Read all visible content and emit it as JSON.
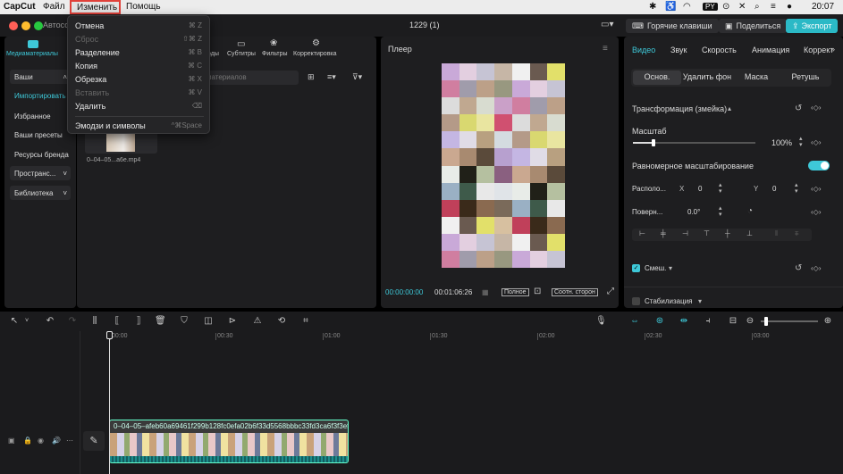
{
  "menubar": {
    "app_name": "CapCut",
    "file": "Файл",
    "edit": "Изменить",
    "help": "Помощь",
    "input_lang": "PY",
    "clock": "20:07"
  },
  "titlebar": {
    "project_title": "Автосо",
    "center_title": "1229 (1)",
    "hotkeys": "Горячие клавиши",
    "share": "Поделиться",
    "export": "Экспорт"
  },
  "edit_menu": {
    "items": [
      {
        "label": "Отмена",
        "key": "⌘ Z",
        "enabled": true
      },
      {
        "label": "Сброс",
        "key": "⇧⌘ Z",
        "enabled": false
      },
      {
        "label": "Разделение",
        "key": "⌘ B",
        "enabled": true
      },
      {
        "label": "Копия",
        "key": "⌘ C",
        "enabled": true
      },
      {
        "label": "Обрезка",
        "key": "⌘ X",
        "enabled": true
      },
      {
        "label": "Вставить",
        "key": "⌘ V",
        "enabled": false
      },
      {
        "label": "Удалить",
        "key": "⌫",
        "enabled": true
      },
      {
        "label": "Эмодзи и символы",
        "key": "^⌘Space",
        "enabled": true
      }
    ]
  },
  "leftnav": {
    "media_tab": "Медиаматериалы",
    "items": [
      "Ваши",
      "Импортировать",
      "Избранное",
      "Ваши пресеты",
      "Ресурсы бренда",
      "Пространс...",
      "Библиотека"
    ]
  },
  "media_toolbar": {
    "tabs": [
      "оды",
      "Субтитры",
      "Фильтры",
      "Корректировка"
    ],
    "search_placeholder": "материалов"
  },
  "media": {
    "file_name": "0–04–05...a6e.mp4"
  },
  "player": {
    "title": "Плеер",
    "current_time": "00:00:00:00",
    "duration": "00:01:06:26",
    "fullscreen_btn": "Полное",
    "ratio_btn": "Соотн. сторон"
  },
  "inspector": {
    "tabs": [
      "Видео",
      "Звук",
      "Скорость",
      "Анимация",
      "Коррект"
    ],
    "segments": [
      "Основ.",
      "Удалить фон",
      "Маска",
      "Ретушь"
    ],
    "transform_title": "Трансформация (змейка)",
    "scale_label": "Масштаб",
    "scale_value": "100%",
    "scale_level": 0.17,
    "uniform_scale": "Равномерное масштабирование",
    "position_label": "Располо...",
    "x_label": "X",
    "x_value": "0",
    "y_label": "Y",
    "y_value": "0",
    "rotate_label": "Поверн...",
    "rotate_value": "0.0°",
    "blend_label": "Смеш.",
    "stabilize_label": "Стабилизация"
  },
  "timeline": {
    "ticks": [
      "00:00",
      "00:30",
      "01:00",
      "01:30",
      "02:00",
      "02:30",
      "03:00"
    ],
    "clip_name": "0–04–05–afeb60a69461f299b128fc0efa02b6f33d5568bbbc33fd3ca6f3f3ef"
  },
  "colors": {
    "accent": "#3ec8d8",
    "export_bg": "#2bb9c6",
    "highlight_box": "#e0413a"
  }
}
